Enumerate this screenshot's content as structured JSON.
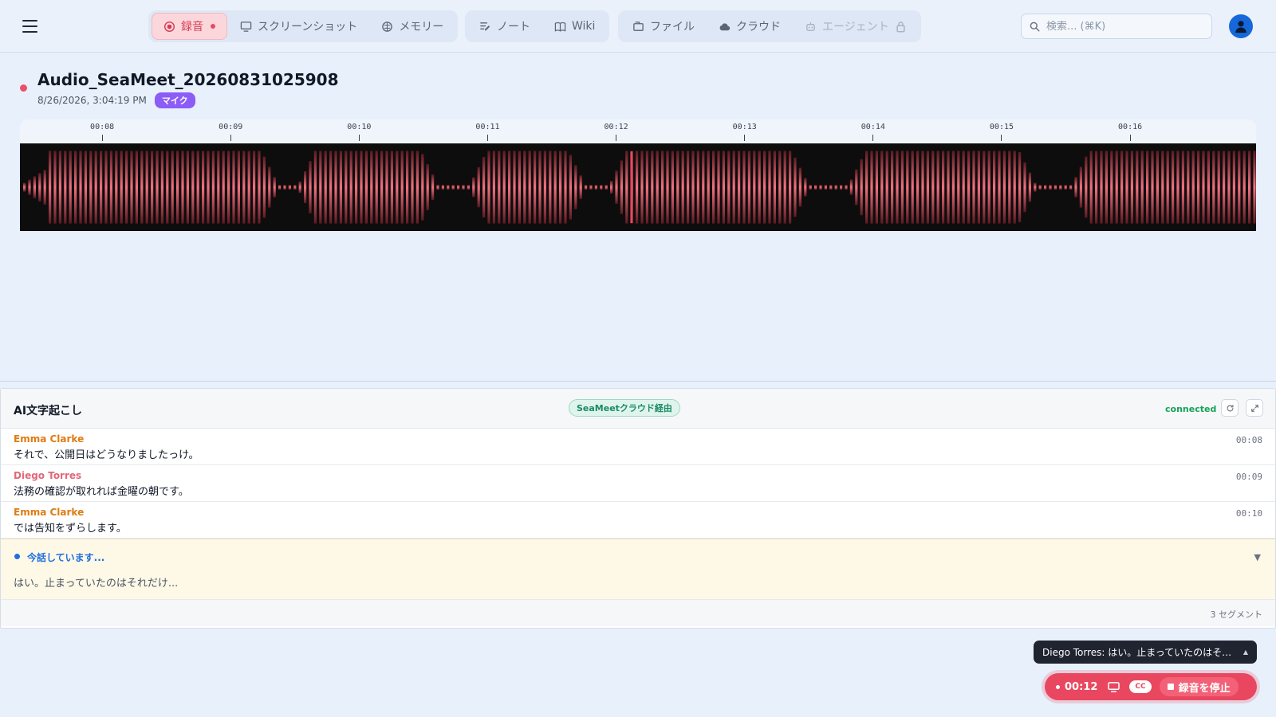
{
  "nav": {
    "groups": [
      [
        {
          "id": "record",
          "label": "録音",
          "icon": "record-icon",
          "active": true,
          "recording": true
        },
        {
          "id": "screenshot",
          "label": "スクリーンショット",
          "icon": "monitor-icon"
        },
        {
          "id": "memory",
          "label": "メモリー",
          "icon": "brain-icon"
        }
      ],
      [
        {
          "id": "notes",
          "label": "ノート",
          "icon": "note-icon"
        },
        {
          "id": "wiki",
          "label": "Wiki",
          "icon": "book-icon"
        }
      ],
      [
        {
          "id": "files",
          "label": "ファイル",
          "icon": "folder-icon"
        },
        {
          "id": "cloud",
          "label": "クラウド",
          "icon": "cloud-icon"
        },
        {
          "id": "agent",
          "label": "エージェント",
          "icon": "robot-icon",
          "disabled": true,
          "locked": true
        }
      ]
    ]
  },
  "search": {
    "placeholder": "検索... (⌘K)"
  },
  "recording": {
    "title": "Audio_SeaMeet_20260831025908",
    "timestamp": "8/26/2026, 3:04:19 PM",
    "source_badge": "マイク",
    "accent_color": "#e9475f",
    "timeline": {
      "start_seconds": 7.36,
      "end_seconds": 16.98,
      "playhead_seconds": 12.12,
      "ticks": [
        "00:08",
        "00:09",
        "00:10",
        "00:11",
        "00:12",
        "00:13",
        "00:14",
        "00:15",
        "00:16"
      ]
    }
  },
  "transcript": {
    "title": "AI文字起こし",
    "source": "SeaMeetクラウド経由",
    "status": "connected",
    "segments": [
      {
        "speaker": "Emma Clarke",
        "color": "#e07b12",
        "text": "それで、公開日はどうなりましたっけ。",
        "time": "00:08"
      },
      {
        "speaker": "Diego Torres",
        "color": "#e0687a",
        "text": "法務の確認が取れれば金曜の朝です。",
        "time": "00:09"
      },
      {
        "speaker": "Emma Clarke",
        "color": "#e07b12",
        "text": "では告知をずらします。",
        "time": "00:10"
      }
    ],
    "live": {
      "label": "今話しています...",
      "text": "はい。止まっていたのはそれだけ..."
    },
    "segment_count": "3 セグメント"
  },
  "floating": {
    "toast": "Diego Torres: はい。止まっていたのはそれだけ...",
    "timer": "00:12",
    "cc_label": "CC",
    "stop_label": "録音を停止"
  }
}
